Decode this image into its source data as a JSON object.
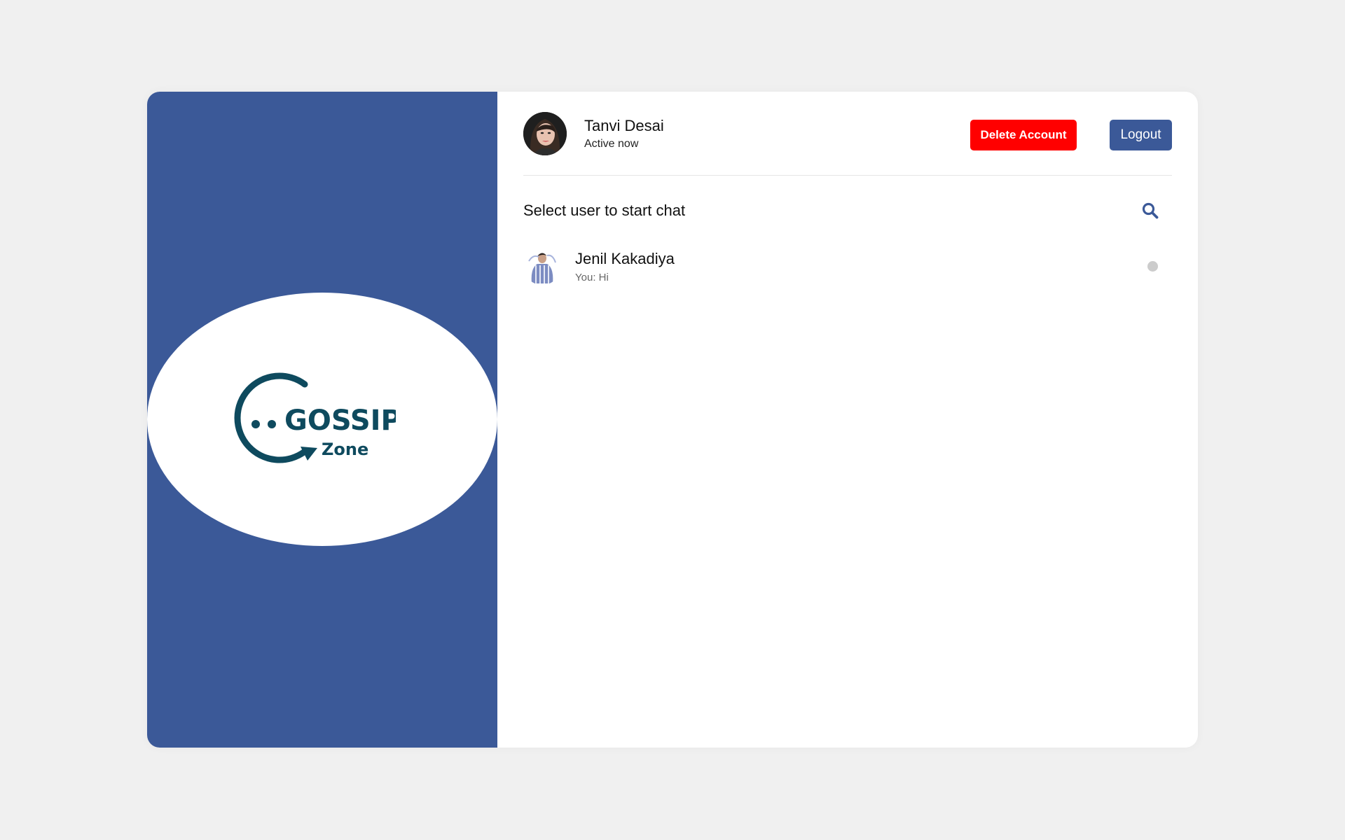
{
  "brand": {
    "logo_title": "GOSSIP",
    "logo_subtitle": "Zone",
    "panel_color": "#3b5998",
    "logo_color": "#0e4a5e"
  },
  "header": {
    "user_name": "Tanvi Desai",
    "user_status": "Active now",
    "delete_label": "Delete Account",
    "logout_label": "Logout",
    "delete_color": "#ff0000",
    "logout_color": "#3b5998"
  },
  "search": {
    "label": "Select user to start chat",
    "icon": "search-icon"
  },
  "chats": [
    {
      "name": "Jenil Kakadiya",
      "last_message": "You: Hi",
      "status": "offline",
      "status_color": "#cccccc"
    }
  ]
}
